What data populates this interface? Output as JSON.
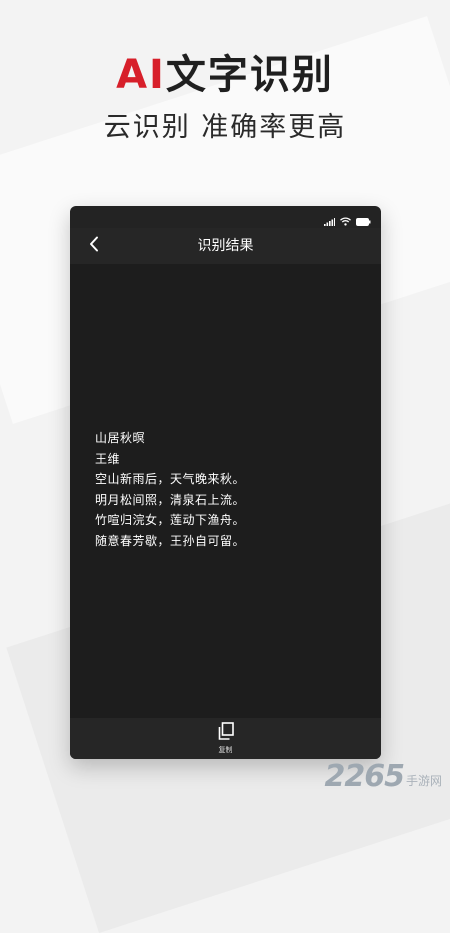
{
  "promo": {
    "headline_accent": "AI",
    "headline_rest": "文字识别",
    "subline": "云识别 准确率更高"
  },
  "phone": {
    "status_icons": [
      "signal-icon",
      "wifi-icon",
      "battery-icon"
    ],
    "nav": {
      "back_icon": "chevron-left-icon",
      "title": "识别结果"
    },
    "result_lines": [
      "山居秋暝",
      "王维",
      "空山新雨后，天气晚来秋。",
      "明月松间照，清泉石上流。",
      "竹喧归浣女，莲动下渔舟。",
      "随意春芳歇，王孙自可留。"
    ],
    "toolbar": {
      "copy_icon": "copy-icon",
      "copy_label": "复制"
    }
  },
  "watermark": {
    "number": "2265",
    "text": "手游网"
  },
  "colors": {
    "accent": "#d71f2a",
    "phone_bg": "#1d1d1d",
    "bar_bg": "#262626",
    "page_bg": "#f3f3f3"
  }
}
